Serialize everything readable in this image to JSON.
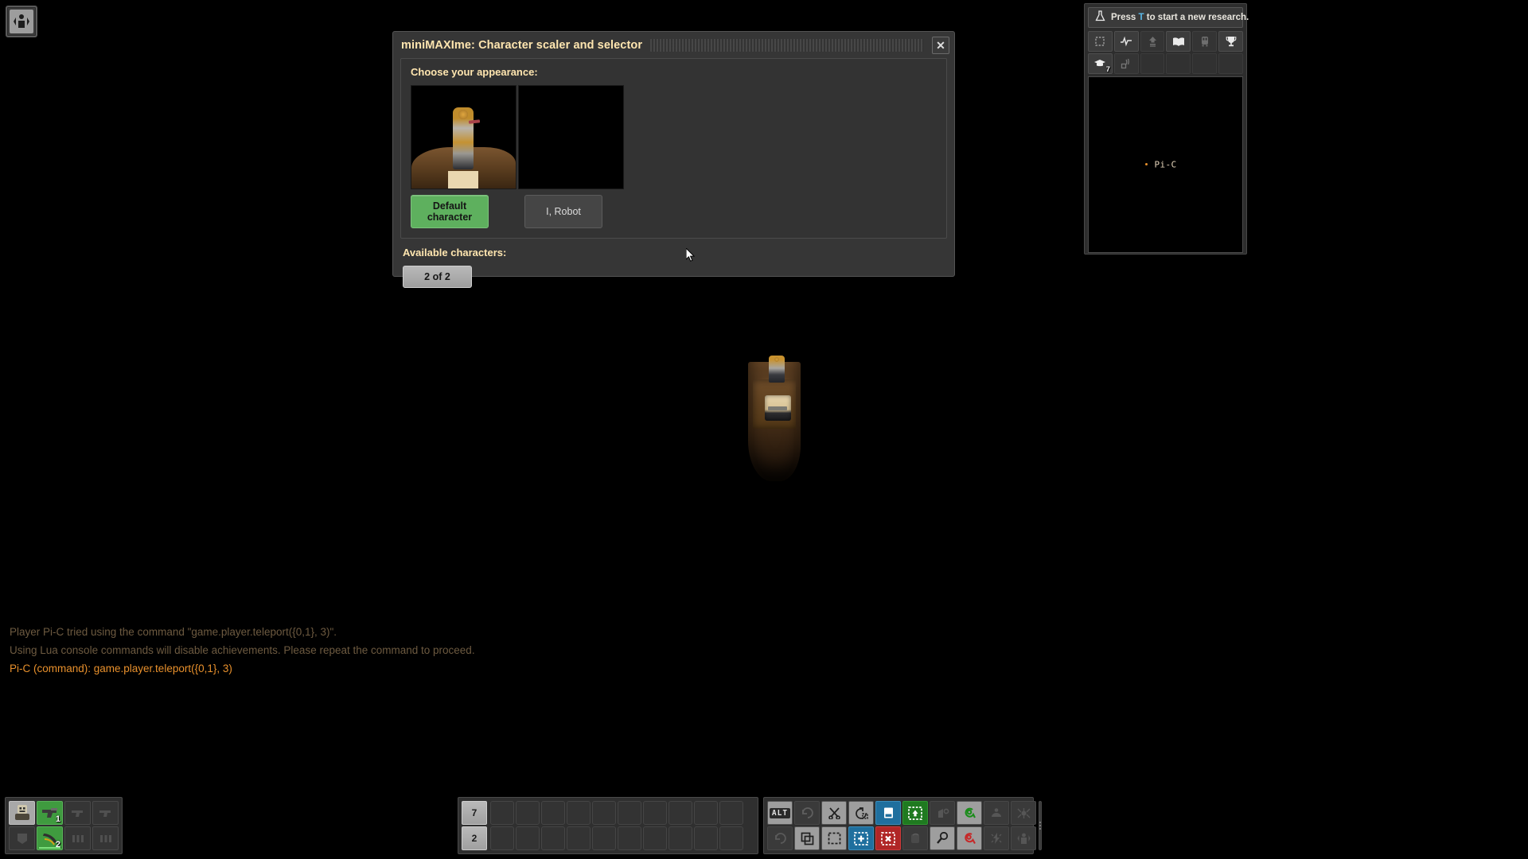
{
  "mod_button": {
    "icon": "character-scaler-icon"
  },
  "dialog": {
    "title": "miniMAXIme: Character scaler and selector",
    "close_label": "✕",
    "appearance": {
      "label": "Choose your appearance:",
      "options": [
        {
          "name": "Default character",
          "selected": true,
          "preview": "character-sprite"
        },
        {
          "name": "I, Robot",
          "selected": false,
          "preview": "empty"
        }
      ]
    },
    "available": {
      "label": "Available characters:",
      "counter": "2 of 2"
    }
  },
  "console": {
    "lines": [
      {
        "text": "Player Pi-C tried using the command \"game.player.teleport({0,1}, 3)\".",
        "style": "dim"
      },
      {
        "text": "Using Lua console commands will disable achievements. Please repeat the command to proceed.",
        "style": "dim"
      },
      {
        "text": "Pi-C (command): game.player.teleport({0,1}, 3)",
        "style": "command"
      }
    ]
  },
  "research": {
    "hint_prefix": "Press ",
    "hint_key": "T",
    "hint_suffix": " to start a new research.",
    "flask_icon": "flask-icon",
    "tools_row1": [
      {
        "icon": "map-selection-icon",
        "state": "normal"
      },
      {
        "icon": "production-graph-icon",
        "state": "normal"
      },
      {
        "icon": "upgrade-planner-icon",
        "state": "dim"
      },
      {
        "icon": "factoriopedia-icon",
        "state": "normal"
      },
      {
        "icon": "train-overview-icon",
        "state": "dim"
      },
      {
        "icon": "achievements-icon",
        "state": "normal"
      }
    ],
    "tools_row2": [
      {
        "icon": "technology-icon",
        "state": "normal",
        "badge": "7"
      },
      {
        "icon": "radar-signal-icon",
        "state": "dim"
      },
      {
        "icon": "empty-slot",
        "state": "empty"
      },
      {
        "icon": "empty-slot",
        "state": "empty"
      },
      {
        "icon": "empty-slot",
        "state": "empty"
      },
      {
        "icon": "empty-slot",
        "state": "empty"
      }
    ]
  },
  "minimap": {
    "player_label": "Pi-C"
  },
  "quickbar": {
    "rows": [
      [
        {
          "icon": "character-portrait-icon",
          "style": "portrait"
        },
        {
          "icon": "pistol-icon",
          "style": "green",
          "count": "1"
        },
        {
          "icon": "pistol-icon",
          "style": "empty"
        },
        {
          "icon": "pistol-icon",
          "style": "empty"
        }
      ],
      [
        {
          "icon": "armor-icon",
          "style": "empty"
        },
        {
          "icon": "magazine-icon",
          "style": "green",
          "count": "2",
          "durability": true
        },
        {
          "icon": "ammo-icon",
          "style": "empty"
        },
        {
          "icon": "ammo-icon",
          "style": "empty"
        }
      ]
    ]
  },
  "hotbar": {
    "row_labels": [
      "7",
      "2"
    ],
    "slots_per_row": 10
  },
  "shortcut_bar": {
    "row1": [
      {
        "icon": "alt-mode-icon",
        "label": "ALT",
        "style": "light"
      },
      {
        "icon": "undo-icon",
        "style": "dark"
      },
      {
        "icon": "cut-icon",
        "style": "light"
      },
      {
        "icon": "redo-selection-icon",
        "style": "light"
      },
      {
        "icon": "copy-icon",
        "style": "blue"
      },
      {
        "icon": "upgrade-icon",
        "style": "green"
      },
      {
        "icon": "deconstruct-tag-icon",
        "style": "dark"
      },
      {
        "icon": "give-gun-icon",
        "style": "light"
      },
      {
        "icon": "artillery-icon",
        "style": "dark"
      },
      {
        "icon": "spidertron-icon",
        "style": "dark"
      }
    ],
    "row2": [
      {
        "icon": "undo-alt-icon",
        "style": "dark"
      },
      {
        "icon": "copy-stack-icon",
        "style": "light"
      },
      {
        "icon": "select-area-icon",
        "style": "light"
      },
      {
        "icon": "add-blueprint-icon",
        "style": "blue"
      },
      {
        "icon": "deconstruct-icon",
        "style": "red"
      },
      {
        "icon": "rotate-icon",
        "style": "dark"
      },
      {
        "icon": "pipette-icon",
        "style": "light"
      },
      {
        "icon": "remote-view-icon",
        "style": "light"
      },
      {
        "icon": "discharge-defense-icon",
        "style": "dark"
      },
      {
        "icon": "toggle-personal-icon",
        "style": "dark"
      }
    ]
  }
}
